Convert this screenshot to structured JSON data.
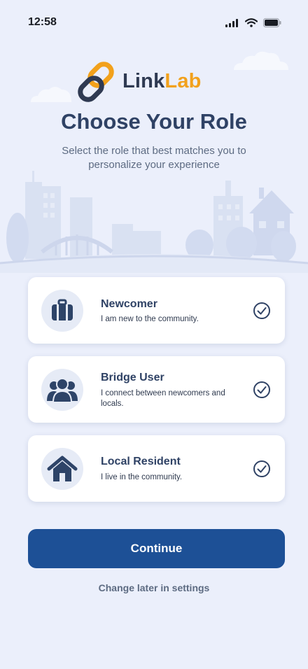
{
  "status_bar": {
    "time": "12:58",
    "icons": [
      "signal-icon",
      "wifi-icon",
      "battery-icon"
    ]
  },
  "brand": {
    "name_part1": "Link",
    "name_part2": "Lab",
    "accent_color": "#f2a11b",
    "primary_color": "#2f3a52"
  },
  "header": {
    "title": "Choose Your Role",
    "subtitle": "Select the role that best matches you to personalize your experience"
  },
  "roles": [
    {
      "title": "Newcomer",
      "description": "I am new to the community.",
      "icon": "suitcase-icon",
      "selected": true
    },
    {
      "title": "Bridge User",
      "description": "I connect between newcomers and locals.",
      "icon": "people-icon",
      "selected": true
    },
    {
      "title": "Local Resident",
      "description": "I live in the community.",
      "icon": "house-icon",
      "selected": true
    }
  ],
  "actions": {
    "continue_label": "Continue",
    "change_later_label": "Change later in settings"
  },
  "colors": {
    "background": "#ebeffb",
    "button": "#1d5096",
    "text_primary": "#2f4265"
  }
}
